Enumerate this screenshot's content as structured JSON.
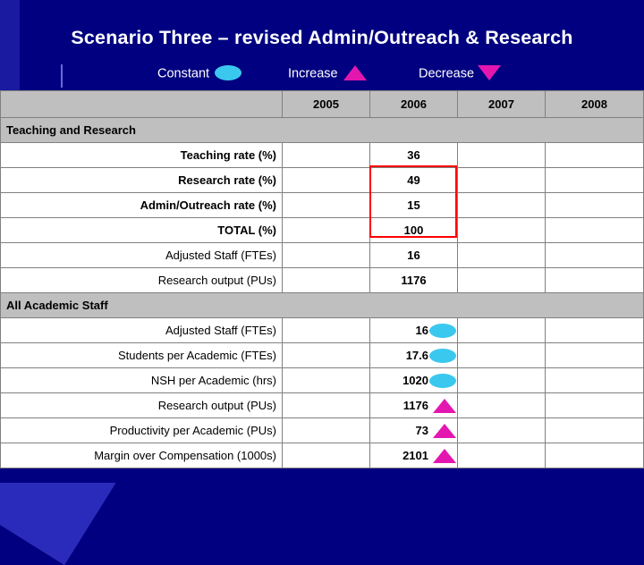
{
  "slide": {
    "title": "Scenario Three – revised Admin/Outreach & Research",
    "legend": [
      {
        "label": "Constant",
        "marker": "ellipse-marker",
        "color": "#3bc8ef"
      },
      {
        "label": "Increase",
        "marker": "triangle-up-marker",
        "color": "#e317b0"
      },
      {
        "label": "Decrease",
        "marker": "triangle-down-marker",
        "color": "#e317b0"
      }
    ],
    "colors": {
      "background": "#000080",
      "title_text": "#ffffff",
      "header_fill": "#bfbfbf",
      "highlight_border": "#ff0000",
      "constant_marker": "#3bc8ef",
      "change_marker": "#e317b0"
    }
  },
  "table": {
    "columns": [
      "",
      "2005",
      "2006",
      "2007",
      "2008"
    ],
    "sections": [
      {
        "name": "Teaching and Research",
        "rows": [
          {
            "label": "Teaching rate (%)",
            "y2005": "",
            "y2006": "36",
            "y2007": "",
            "y2008": "",
            "marker": ""
          },
          {
            "label": "Research rate (%)",
            "y2005": "",
            "y2006": "49",
            "y2007": "",
            "y2008": "",
            "marker": ""
          },
          {
            "label": "Admin/Outreach rate (%)",
            "y2005": "",
            "y2006": "15",
            "y2007": "",
            "y2008": "",
            "marker": ""
          },
          {
            "label": "TOTAL (%)",
            "y2005": "",
            "y2006": "100",
            "y2007": "",
            "y2008": "",
            "marker": "",
            "bold": true
          },
          {
            "label": "Adjusted Staff (FTEs)",
            "y2005": "",
            "y2006": "16",
            "y2007": "",
            "y2008": "",
            "marker": ""
          },
          {
            "label": "Research output (PUs)",
            "y2005": "",
            "y2006": "1176",
            "y2007": "",
            "y2008": "",
            "marker": "",
            "bold": true
          }
        ]
      },
      {
        "name": "All Academic Staff",
        "rows": [
          {
            "label": "Adjusted Staff (FTEs)",
            "y2005": "",
            "y2006": "16",
            "y2007": "",
            "y2008": "",
            "marker": "ellipse-marker"
          },
          {
            "label": "Students per Academic (FTEs)",
            "y2005": "",
            "y2006": "17.6",
            "y2007": "",
            "y2008": "",
            "marker": "ellipse-marker"
          },
          {
            "label": "NSH per Academic (hrs)",
            "y2005": "",
            "y2006": "1020",
            "y2007": "",
            "y2008": "",
            "marker": "ellipse-marker"
          },
          {
            "label": "Research output (PUs)",
            "y2005": "",
            "y2006": "1176",
            "y2007": "",
            "y2008": "",
            "marker": "triangle-up-marker",
            "bold": true
          },
          {
            "label": "Productivity per Academic (PUs)",
            "y2005": "",
            "y2006": "73",
            "y2007": "",
            "y2008": "",
            "marker": "triangle-up-marker",
            "bold": true
          },
          {
            "label": "Margin over Compensation (1000s)",
            "y2005": "",
            "y2006": "2101",
            "y2007": "",
            "y2008": "",
            "marker": "triangle-up-marker",
            "bold": true
          }
        ]
      }
    ],
    "highlight": {
      "column": "2006",
      "rows": [
        "Teaching rate (%)",
        "Research rate (%)",
        "Admin/Outreach rate (%)"
      ]
    }
  }
}
